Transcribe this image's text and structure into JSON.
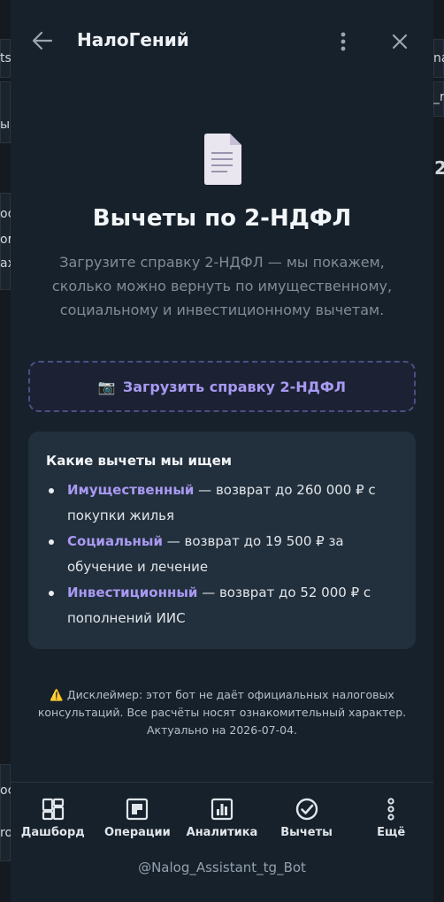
{
  "background": {
    "fragments": [
      "ts",
      "na",
      "_r",
      "ы",
      "2",
      "ос",
      "ом",
      "ах",
      "ос",
      "ro"
    ]
  },
  "header": {
    "title": "НалоГений",
    "back_icon": "arrow-left-icon",
    "menu_icon": "kebab-menu-icon",
    "close_icon": "close-icon"
  },
  "hero": {
    "icon": "document-icon",
    "title": "Вычеты по 2-НДФЛ",
    "subtitle": "Загрузите справку 2-НДФЛ — мы покажем, сколько можно вернуть по имущественному, социальному и инвестиционному вычетам."
  },
  "upload": {
    "icon": "📷",
    "label": "Загрузить справку 2-НДФЛ"
  },
  "deductions": {
    "title": "Какие вычеты мы ищем",
    "items": [
      {
        "name": "Имущественный",
        "text": " — возврат до 260 000 ₽ с покупки жилья"
      },
      {
        "name": "Социальный",
        "text": " — возврат до 19 500 ₽ за обучение и лечение"
      },
      {
        "name": "Инвестиционный",
        "text": " — возврат до 52 000 ₽ с пополнений ИИС"
      }
    ]
  },
  "disclaimer": {
    "icon": "⚠️",
    "text": "Дисклеймер: этот бот не даёт официальных налоговых консультаций. Все расчёты носят ознакомительный характер. Актуально на 2026-07-04."
  },
  "nav": {
    "items": [
      {
        "label": "Дашборд",
        "icon": "dashboard-icon"
      },
      {
        "label": "Операции",
        "icon": "operations-icon"
      },
      {
        "label": "Аналитика",
        "icon": "analytics-icon"
      },
      {
        "label": "Вычеты",
        "icon": "check-circle-icon",
        "active": true
      },
      {
        "label": "Ещё",
        "icon": "more-dots-icon"
      }
    ]
  },
  "footer": {
    "bot_name": "@Nalog_Assistant_tg_Bot"
  },
  "colors": {
    "panel_bg": "#17212b",
    "accent": "#a899f2",
    "card_bg": "#222f3c",
    "muted": "#7f8c99"
  }
}
